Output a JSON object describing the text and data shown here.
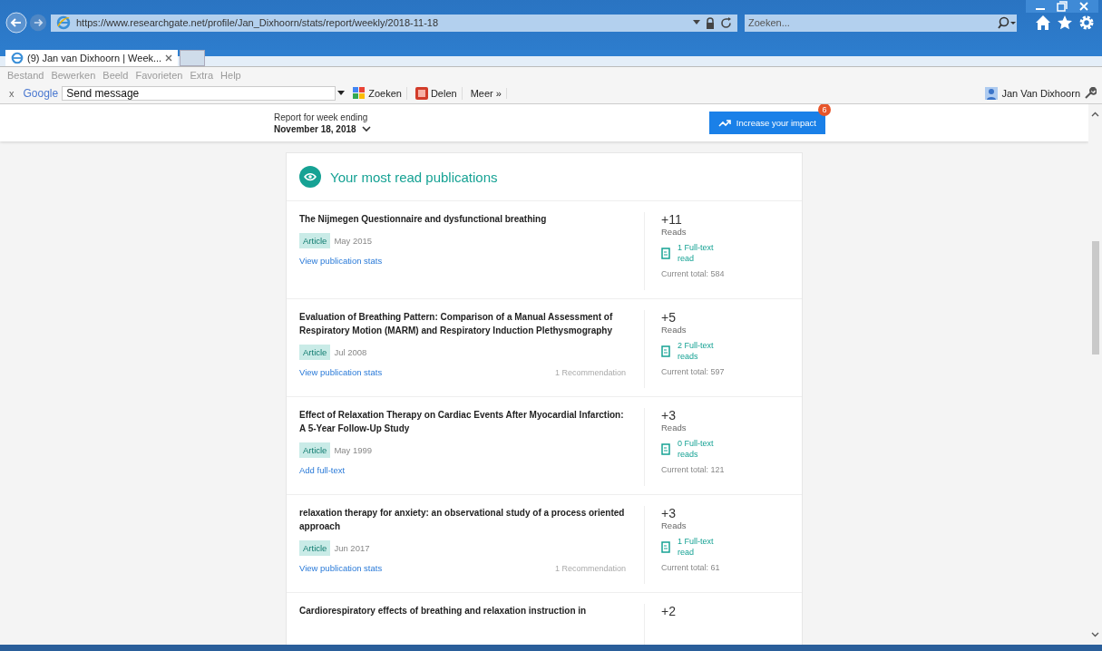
{
  "browser": {
    "address": "https://www.researchgate.net/profile/Jan_Dixhoorn/stats/report/weekly/2018-11-18",
    "search": {
      "placeholder": "Zoeken..."
    },
    "tabs": [
      {
        "label": "(9) Jan van Dixhoorn | Week...",
        "selected": true
      }
    ],
    "menu": [
      "Bestand",
      "Bewerken",
      "Beeld",
      "Favorieten",
      "Extra",
      "Help"
    ],
    "toolbar": {
      "close": "x",
      "brand": "Google",
      "search_value": "Send message",
      "buttons": [
        "Zoeken",
        "Delen",
        "Meer »"
      ],
      "user": "Jan Van Dixhoorn"
    }
  },
  "header": {
    "label": "Report for week ending",
    "week": "November 18, 2018",
    "button": "Increase your impact",
    "badge": "6"
  },
  "card": {
    "title": "Your most read publications",
    "publications": [
      {
        "title": "The Nijmegen Questionnaire and dysfunctional breathing",
        "type": "Article",
        "date": "May 2015",
        "link": "View publication stats",
        "reads": "+11",
        "reads_label": "Reads",
        "fulltext": "1 Full-text read",
        "total": "Current total: 584"
      },
      {
        "title": "Evaluation of Breathing Pattern: Comparison of a Manual Assessment of Respiratory Motion (MARM) and Respiratory Induction Plethysmography",
        "type": "Article",
        "date": "Jul 2008",
        "link": "View publication stats",
        "recommendation": "1 Recommendation",
        "reads": "+5",
        "reads_label": "Reads",
        "fulltext": "2 Full-text reads",
        "total": "Current total: 597"
      },
      {
        "title": "Effect of Relaxation Therapy on Cardiac Events After Myocardial Infarction: A 5-Year Follow-Up Study",
        "type": "Article",
        "date": "May 1999",
        "link": "Add full-text",
        "reads": "+3",
        "reads_label": "Reads",
        "fulltext": "0 Full-text reads",
        "total": "Current total: 121"
      },
      {
        "title": "relaxation therapy for anxiety: an observational study of a process oriented approach",
        "type": "Article",
        "date": "Jun 2017",
        "link": "View publication stats",
        "recommendation": "1 Recommendation",
        "reads": "+3",
        "reads_label": "Reads",
        "fulltext": "1 Full-text read",
        "total": "Current total: 61"
      },
      {
        "title": "Cardiorespiratory effects of breathing and relaxation instruction in",
        "reads": "+2"
      }
    ]
  }
}
